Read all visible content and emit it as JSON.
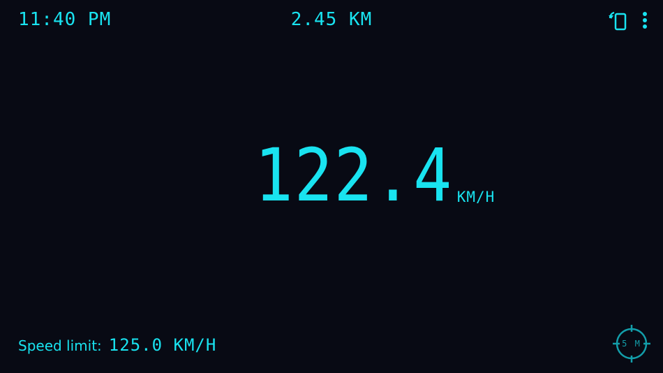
{
  "status_bar": {
    "time": "11:40 PM",
    "distance": "2.45 KM"
  },
  "toolbar": {
    "rotate_icon": "rotate-screen-icon",
    "menu_icon": "more-vertical-icon"
  },
  "speedometer": {
    "speed": "122.4",
    "unit": "KM/H"
  },
  "speed_limit": {
    "label": "Speed limit:",
    "value": "125.0 KM/H"
  },
  "gps": {
    "accuracy": "5 M",
    "icon": "crosshair-icon"
  },
  "colors": {
    "background": "#080a14",
    "accent": "#19e3f0",
    "accent_dim": "#139eaa"
  }
}
